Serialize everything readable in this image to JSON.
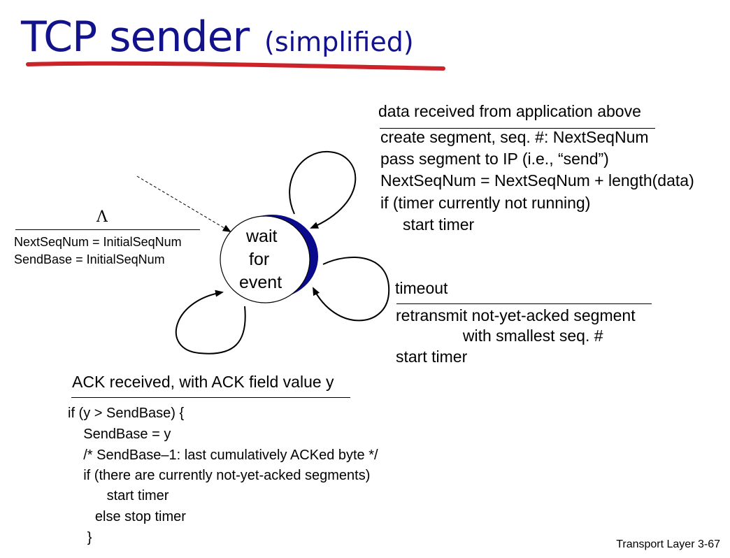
{
  "title": {
    "main": "TCP sender",
    "sub": "(simplified)"
  },
  "state": {
    "lines": [
      "wait",
      "for",
      "event"
    ]
  },
  "init": {
    "event": "Λ",
    "actions": [
      "NextSeqNum = InitialSeqNum",
      "SendBase = InitialSeqNum"
    ]
  },
  "data_transition": {
    "event": "data received from application above",
    "actions": [
      "create segment, seq. #: NextSeqNum",
      "pass segment to IP (i.e., “send”)",
      "NextSeqNum = NextSeqNum + length(data)",
      "if (timer currently not running)",
      "     start timer"
    ]
  },
  "timeout_transition": {
    "event": "timeout",
    "actions": [
      "retransmit not-yet-acked segment",
      "               with smallest seq. #",
      "start timer"
    ]
  },
  "ack_transition": {
    "event": "ACK received, with ACK field value y",
    "actions": [
      "if (y > SendBase) {",
      "    SendBase = y",
      "    /* SendBase–1: last cumulatively ACKed byte */",
      "    if (there are currently not-yet-acked segments)",
      "          start timer",
      "       else stop timer",
      "     }"
    ]
  },
  "footer": "Transport Layer 3-67",
  "colors": {
    "title": "#12128a",
    "underline": "#cc2229",
    "state_shadow": "#0a0a8c"
  }
}
